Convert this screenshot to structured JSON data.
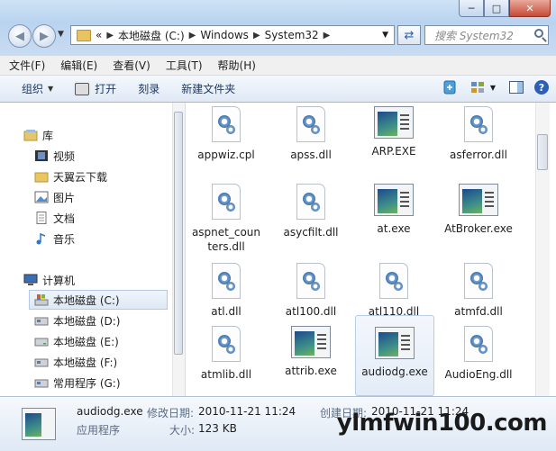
{
  "window": {
    "caption_buttons": [
      "─",
      "□",
      "✕"
    ]
  },
  "address": {
    "crumbs": [
      "«",
      "本地磁盘 (C:)",
      "Windows",
      "System32"
    ]
  },
  "search": {
    "placeholder": "搜索 System32"
  },
  "menu": [
    "文件(F)",
    "编辑(E)",
    "查看(V)",
    "工具(T)",
    "帮助(H)"
  ],
  "commands": {
    "organize": "组织",
    "open": "打开",
    "burn": "刻录",
    "new_folder": "新建文件夹"
  },
  "nav": {
    "library_header": "库",
    "libraries": [
      "视频",
      "天翼云下载",
      "图片",
      "文档",
      "音乐"
    ],
    "computer_header": "计算机",
    "drives": [
      "本地磁盘 (C:)",
      "本地磁盘 (D:)",
      "本地磁盘 (E:)",
      "本地磁盘 (F:)",
      "常用程序 (G:)"
    ],
    "selected_drive": "本地磁盘 (C:)"
  },
  "files": [
    {
      "name": "appwiz.cpl",
      "type": "dll"
    },
    {
      "name": "apss.dll",
      "type": "dll"
    },
    {
      "name": "ARP.EXE",
      "type": "exe"
    },
    {
      "name": "asferror.dll",
      "type": "dll"
    },
    {
      "name": "aspnet_counters.dll",
      "type": "dll"
    },
    {
      "name": "asycfilt.dll",
      "type": "dll"
    },
    {
      "name": "at.exe",
      "type": "exe"
    },
    {
      "name": "AtBroker.exe",
      "type": "exe"
    },
    {
      "name": "atl.dll",
      "type": "dll"
    },
    {
      "name": "atl100.dll",
      "type": "dll"
    },
    {
      "name": "atl110.dll",
      "type": "dll"
    },
    {
      "name": "atmfd.dll",
      "type": "dll"
    },
    {
      "name": "atmlib.dll",
      "type": "dll"
    },
    {
      "name": "attrib.exe",
      "type": "exe"
    },
    {
      "name": "audiodg.exe",
      "type": "exe",
      "selected": true
    },
    {
      "name": "AudioEng.dll",
      "type": "dll"
    }
  ],
  "details": {
    "name": "audiodg.exe",
    "type": "应用程序",
    "modified_label": "修改日期:",
    "modified": "2010-11-21 11:24",
    "created_label": "创建日期:",
    "created": "2010-11-21 11:24",
    "size_label": "大小:",
    "size": "123 KB"
  },
  "watermark": "ylmfwin100.com"
}
